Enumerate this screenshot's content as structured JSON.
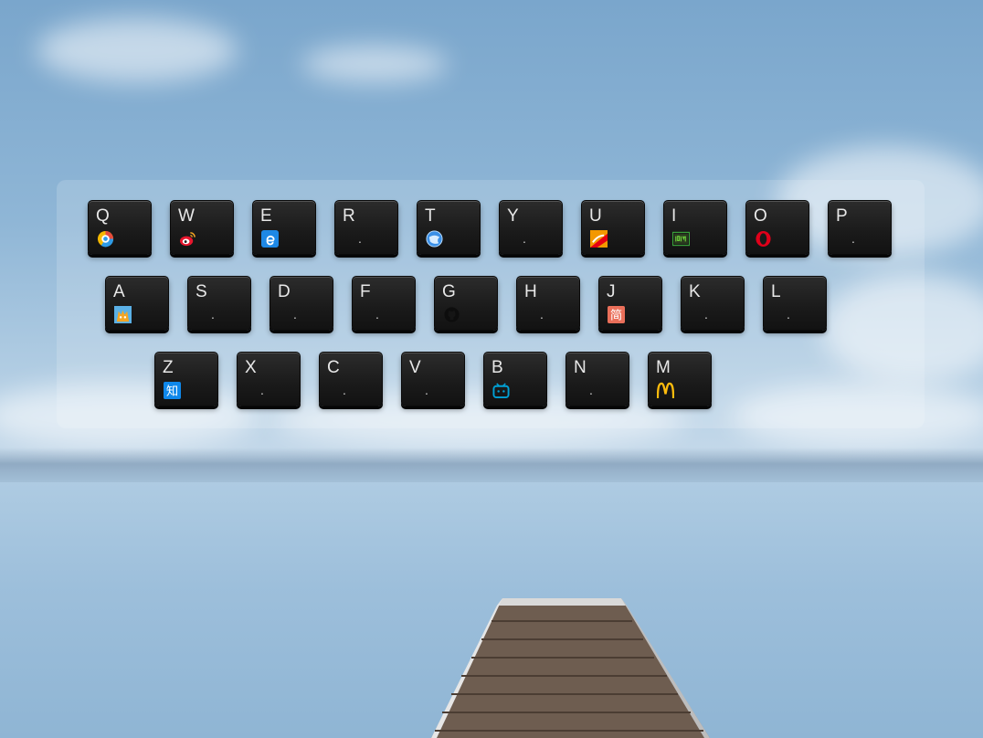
{
  "keyboard": {
    "row1": [
      {
        "letter": "Q",
        "site": "qq-browser",
        "icon": "qq-browser-icon"
      },
      {
        "letter": "W",
        "site": "weibo",
        "icon": "weibo-icon"
      },
      {
        "letter": "E",
        "site": "edge",
        "icon": "edge-icon"
      },
      {
        "letter": "R",
        "site": "",
        "dot": "."
      },
      {
        "letter": "T",
        "site": "tencent-video",
        "icon": "globe-icon"
      },
      {
        "letter": "Y",
        "site": "",
        "dot": "."
      },
      {
        "letter": "U",
        "site": "youku",
        "icon": "youku-icon"
      },
      {
        "letter": "I",
        "site": "iqiyi",
        "icon": "iqiyi-icon"
      },
      {
        "letter": "O",
        "site": "opera",
        "icon": "opera-icon"
      },
      {
        "letter": "P",
        "site": "",
        "dot": "."
      }
    ],
    "row2": [
      {
        "letter": "A",
        "site": "acfun",
        "icon": "acfun-icon"
      },
      {
        "letter": "S",
        "site": "",
        "dot": "."
      },
      {
        "letter": "D",
        "site": "",
        "dot": "."
      },
      {
        "letter": "F",
        "site": "",
        "dot": "."
      },
      {
        "letter": "G",
        "site": "github",
        "icon": "github-icon"
      },
      {
        "letter": "H",
        "site": "",
        "dot": "."
      },
      {
        "letter": "J",
        "site": "jianshu",
        "icon": "jianshu-icon",
        "glyph": "简"
      },
      {
        "letter": "K",
        "site": "",
        "dot": "."
      },
      {
        "letter": "L",
        "site": "",
        "dot": "."
      }
    ],
    "row3": [
      {
        "letter": "Z",
        "site": "zhihu",
        "icon": "zhihu-icon",
        "glyph": "知"
      },
      {
        "letter": "X",
        "site": "",
        "dot": "."
      },
      {
        "letter": "C",
        "site": "",
        "dot": "."
      },
      {
        "letter": "V",
        "site": "",
        "dot": "."
      },
      {
        "letter": "B",
        "site": "bilibili",
        "icon": "bilibili-icon"
      },
      {
        "letter": "N",
        "site": "",
        "dot": "."
      },
      {
        "letter": "M",
        "site": "mcdonalds",
        "icon": "mcdonalds-icon",
        "glyph": "M"
      }
    ]
  },
  "colors": {
    "key_bg": "#1a1a1a",
    "key_text": "#e8e8e8",
    "panel": "rgba(255,255,255,0.16)",
    "zhihu": "#0f88eb",
    "jianshu": "#ea6f5a",
    "mcdonalds": "#ffbc0d",
    "bilibili": "#00a1d6",
    "opera": "#e0001a",
    "iqiyi": "#00be06"
  }
}
